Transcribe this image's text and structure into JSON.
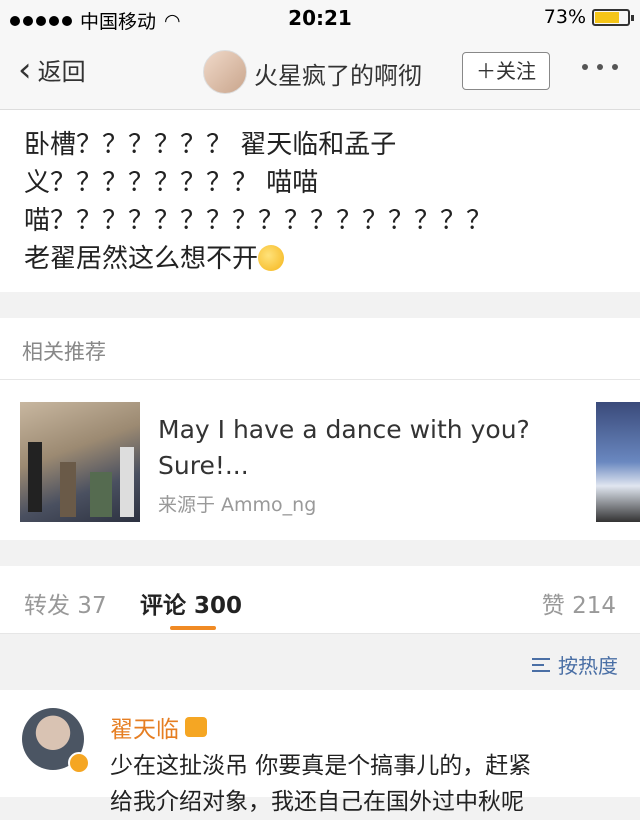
{
  "status_bar": {
    "carrier": "中国移动",
    "time": "20:21",
    "battery": "73%",
    "battery_level": 0.73
  },
  "nav": {
    "back_label": "返回",
    "title": "火星疯了的啊彻",
    "follow_label": "＋关注"
  },
  "post": {
    "lines": [
      "卧槽？？？？？？ 翟天临和孟子",
      "义？？？？？？？？ 喵喵",
      "喵？？？？？？？？？？？？？？？？？",
      "老翟居然这么想不开"
    ]
  },
  "related": {
    "header": "相关推荐",
    "card": {
      "title": "May I have a dance with you? Sure!...",
      "source": "来源于 Ammo_ng"
    }
  },
  "counts": {
    "repost": "转发 37",
    "comment": "评论 300",
    "like": "赞 214"
  },
  "sort": {
    "label": "按热度"
  },
  "comment": {
    "author": "翟天临",
    "text_line1": "少在这扯淡吊 你要真是个搞事儿的，赶紧",
    "text_line2": "给我介绍对象，我还自己在国外过中秋呢"
  },
  "colors": {
    "accent": "#f08a24",
    "link": "#4a6fa5",
    "name": "#e67e22"
  }
}
